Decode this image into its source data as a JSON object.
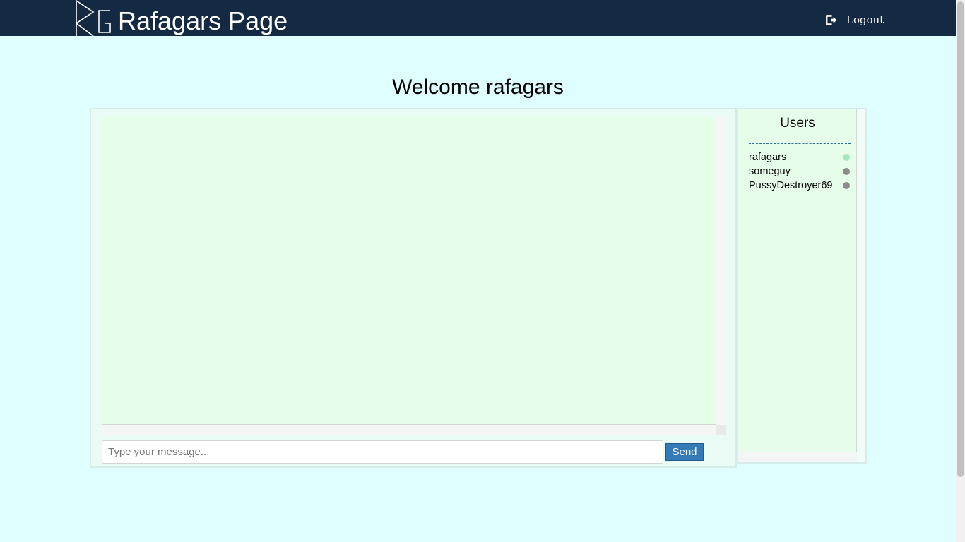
{
  "navbar": {
    "logo_text": "RG",
    "brand_title": "Rafagars Page",
    "logout_label": "Logout"
  },
  "welcome": {
    "heading": "Welcome rafagars"
  },
  "chat": {
    "input_placeholder": "Type your message...",
    "input_value": "",
    "send_label": "Send"
  },
  "users_panel": {
    "title": "Users",
    "users": [
      {
        "name": "rafagars",
        "status": "online",
        "status_color": "#a6e6bd"
      },
      {
        "name": "someguy",
        "status": "offline",
        "status_color": "#8c8c8c"
      },
      {
        "name": "PussyDestroyer69",
        "status": "offline",
        "status_color": "#8c8c8c"
      }
    ]
  },
  "colors": {
    "navbar_bg": "#142a43",
    "page_bg": "#dfffff",
    "chat_bg": "#e6fde9",
    "send_button_bg": "#337ab7"
  }
}
